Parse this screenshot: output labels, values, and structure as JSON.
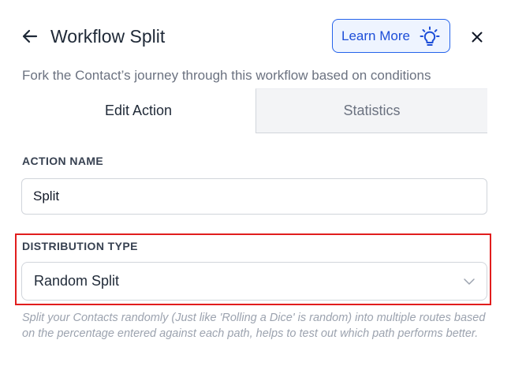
{
  "header": {
    "title": "Workflow Split",
    "back_icon": "arrow-left-icon",
    "learn_more_label": "Learn More",
    "learn_more_icon": "lightbulb-icon",
    "close_icon": "close-icon",
    "accent_color": "#2563eb"
  },
  "subtitle": "Fork the Contact’s journey through this workflow based on conditions",
  "tabs": [
    {
      "label": "Edit Action",
      "active": true
    },
    {
      "label": "Statistics",
      "active": false
    }
  ],
  "form": {
    "action_name_label": "ACTION NAME",
    "action_name_value": "Split",
    "distribution_type_label": "DISTRIBUTION TYPE",
    "distribution_type_value": "Random Split",
    "distribution_type_icon": "chevron-down-icon",
    "distribution_help": "Split your Contacts randomly (Just like 'Rolling a Dice' is random) into multiple routes based on the percentage entered against each path, helps to test out which path performs better.",
    "highlight_color": "#e11d1d"
  }
}
